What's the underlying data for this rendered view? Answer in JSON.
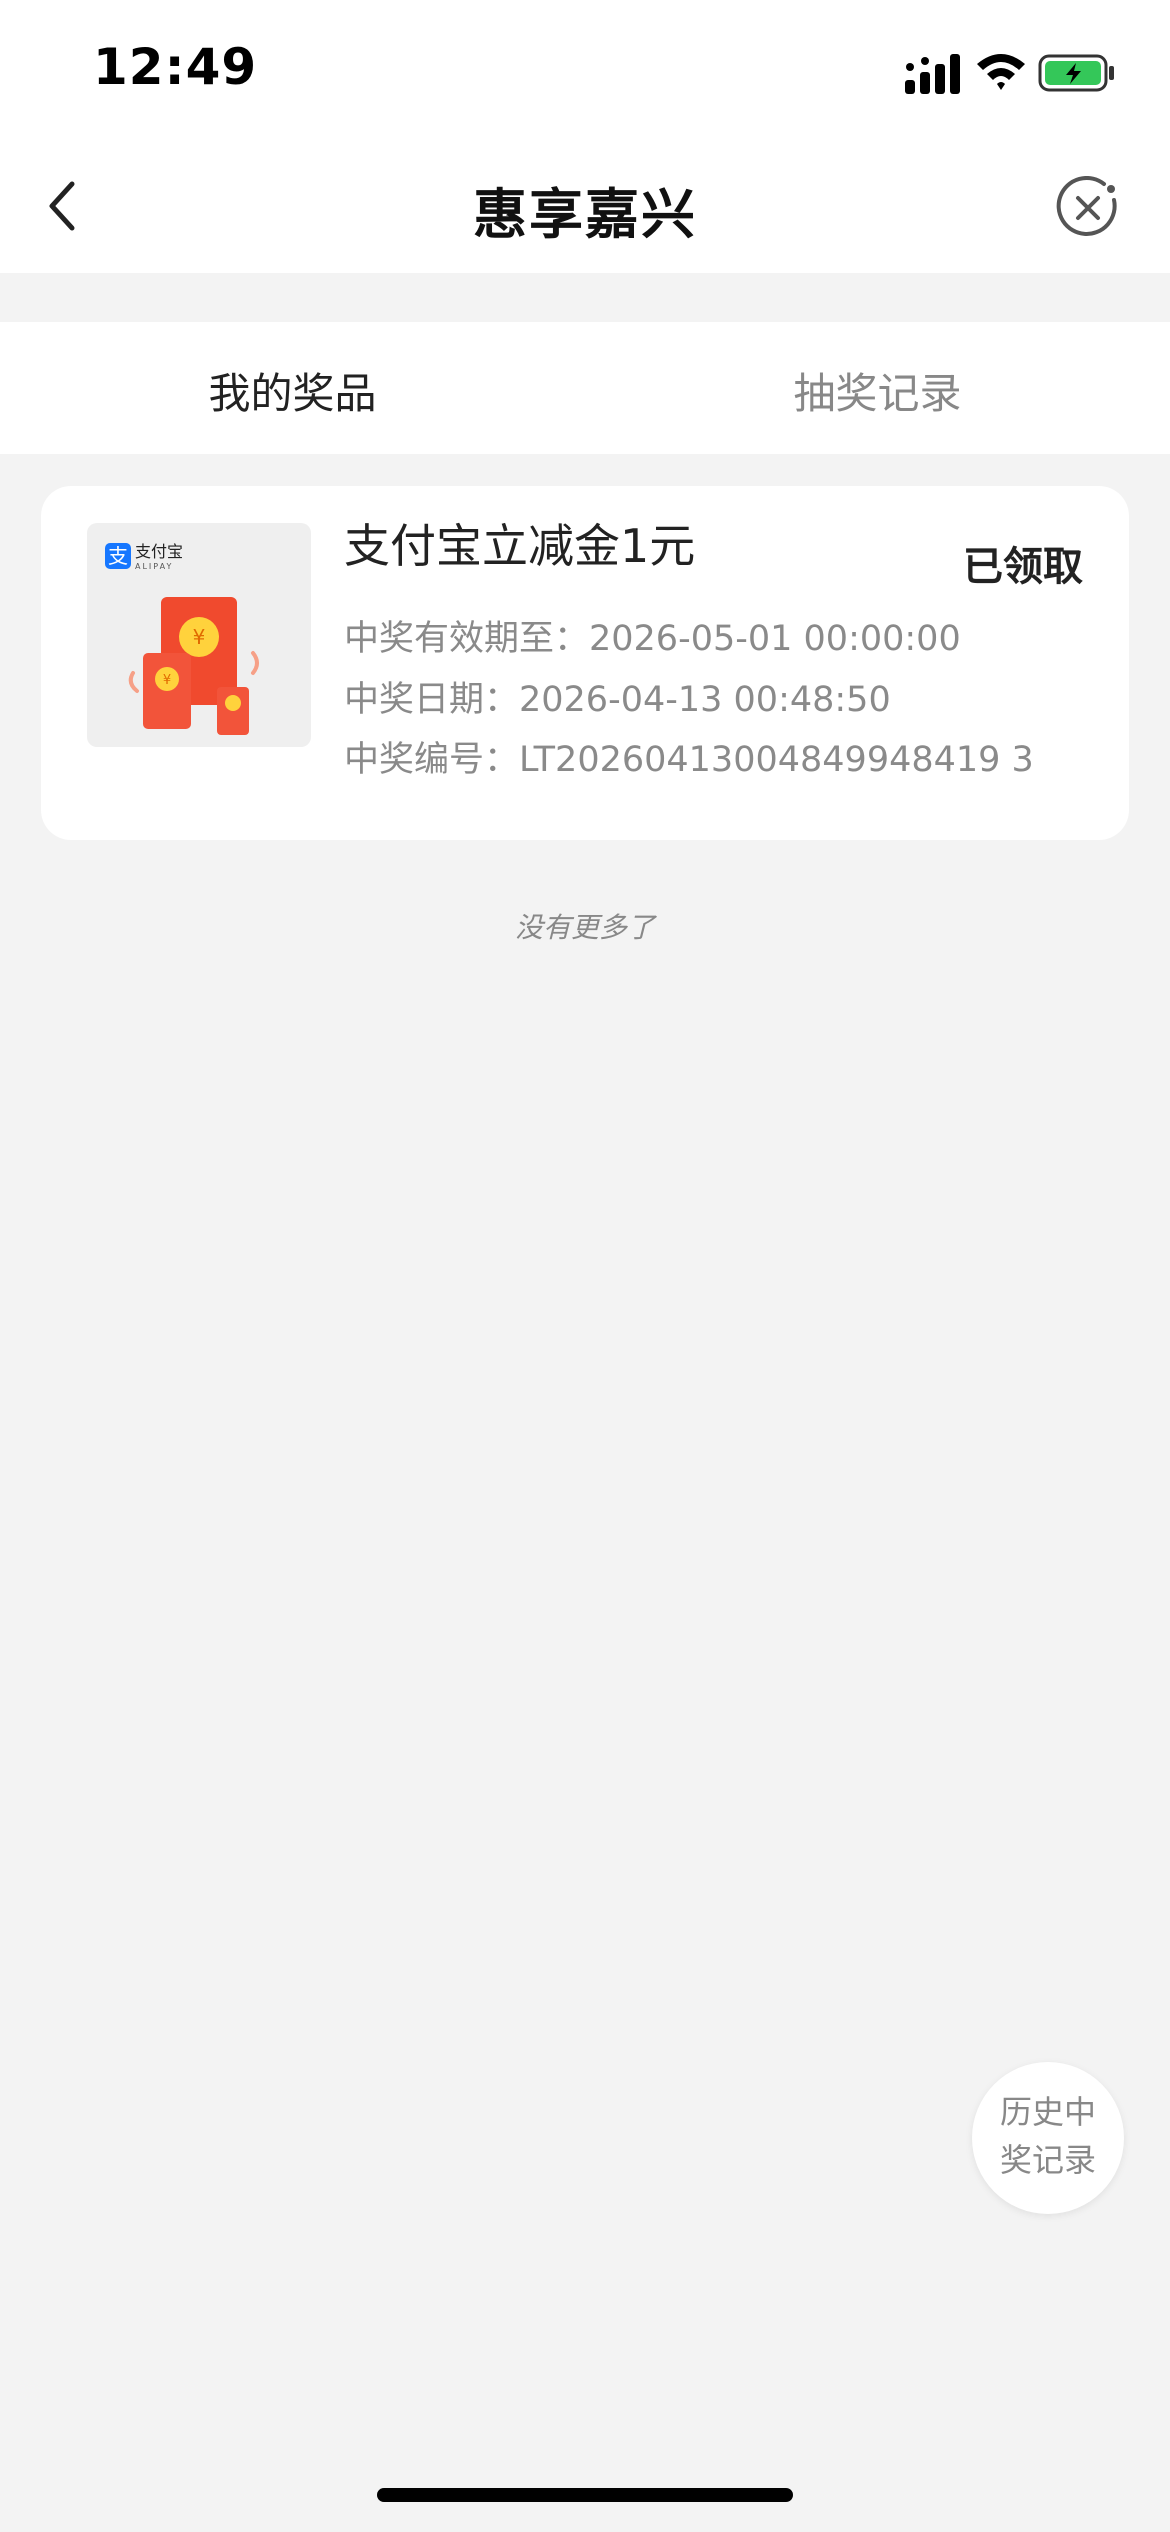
{
  "status_bar": {
    "time": "12:49"
  },
  "nav": {
    "title": "惠享嘉兴"
  },
  "tabs": [
    {
      "label": "我的奖品",
      "active": true
    },
    {
      "label": "抽奖记录",
      "active": false
    }
  ],
  "prizes": [
    {
      "title": "支付宝立减金1元",
      "status": "已领取",
      "valid_until": "中奖有效期至：2026-05-01 00:00:00",
      "win_date": "中奖日期：2026-04-13 00:48:50",
      "win_number": "中奖编号：LT20260413004849948419 3",
      "thumb_brand": "支付宝",
      "thumb_brand_en": "ALIPAY"
    }
  ],
  "footer_note": "没有更多了",
  "history_button": "历史中奖记录",
  "colors": {
    "alipay_blue": "#1677ff",
    "red_packet": "#f04a2e",
    "coin": "#ffd23c",
    "battery_green": "#34c759"
  }
}
